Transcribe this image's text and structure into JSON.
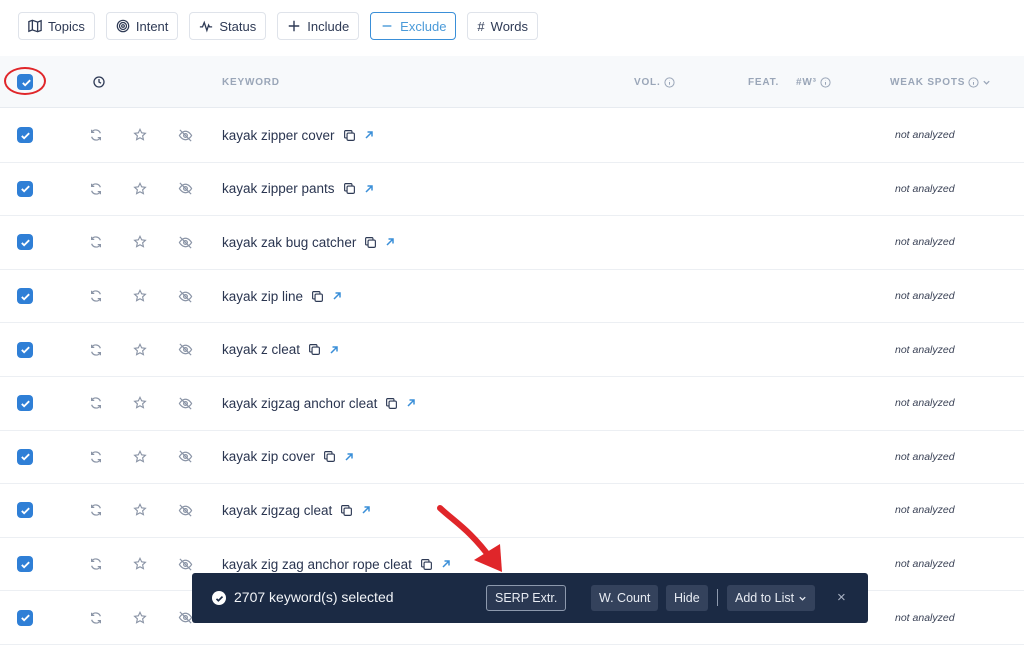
{
  "filters": [
    {
      "label": "Topics",
      "icon": "map-icon"
    },
    {
      "label": "Intent",
      "icon": "target-icon"
    },
    {
      "label": "Status",
      "icon": "pulse-icon"
    },
    {
      "label": "Include",
      "icon": "plus-icon"
    },
    {
      "label": "Exclude",
      "icon": "minus-icon"
    },
    {
      "label": "Words",
      "icon": "hash-icon"
    }
  ],
  "table": {
    "headers": {
      "keyword": "KEYWORD",
      "vol": "VOL.",
      "feat": "FEAT.",
      "wsquared": "#W³",
      "weak_spots": "WEAK SPOTS"
    },
    "rows": [
      {
        "keyword": "kayak zipper cover",
        "weak_spots": "not analyzed"
      },
      {
        "keyword": "kayak zipper pants",
        "weak_spots": "not analyzed"
      },
      {
        "keyword": "kayak zak bug catcher",
        "weak_spots": "not analyzed"
      },
      {
        "keyword": "kayak zip line",
        "weak_spots": "not analyzed"
      },
      {
        "keyword": "kayak z cleat",
        "weak_spots": "not analyzed"
      },
      {
        "keyword": "kayak zigzag anchor cleat",
        "weak_spots": "not analyzed"
      },
      {
        "keyword": "kayak zip cover",
        "weak_spots": "not analyzed"
      },
      {
        "keyword": "kayak zigzag cleat",
        "weak_spots": "not analyzed"
      },
      {
        "keyword": "kayak zig zag anchor rope cleat",
        "weak_spots": "not analyzed"
      },
      {
        "keyword": "",
        "weak_spots": "not analyzed"
      }
    ]
  },
  "action_bar": {
    "selected_text": "2707 keyword(s) selected",
    "serp_button": "SERP Extr.",
    "wcount_button": "W. Count",
    "hide_button": "Hide",
    "add_list_button": "Add to List",
    "close": "×"
  },
  "colors": {
    "accent": "#2f7fd6",
    "annotation": "#e0262a",
    "bar_bg": "#1b2a44"
  }
}
